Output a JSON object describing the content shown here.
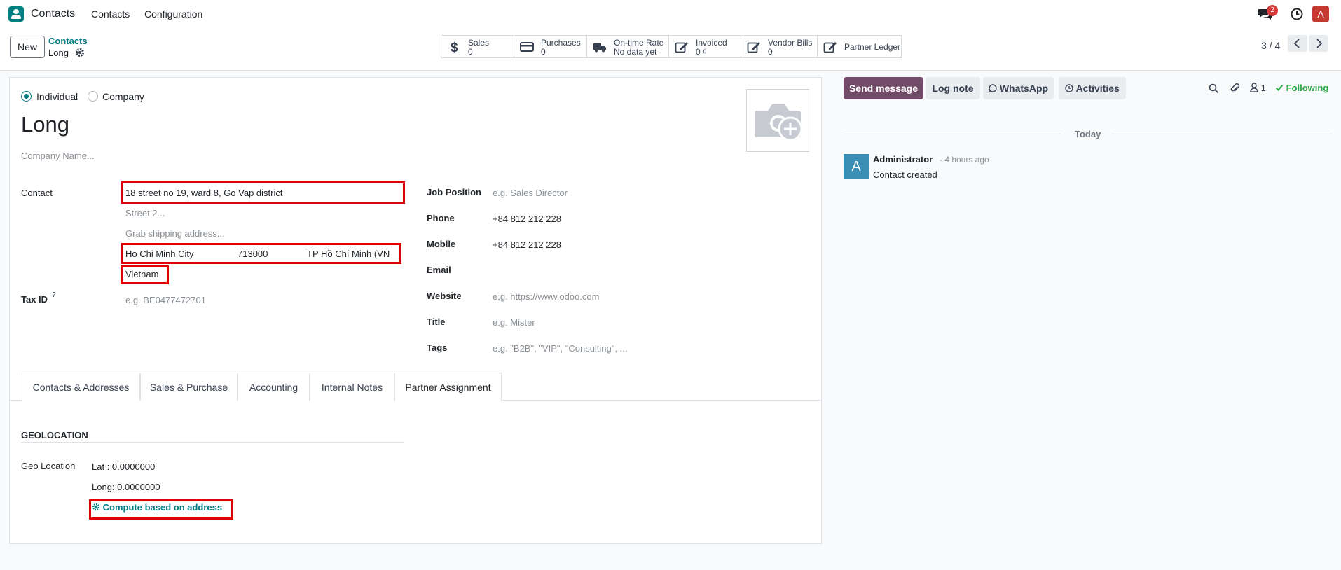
{
  "nav": {
    "app_name": "Contacts",
    "menu": [
      "Contacts",
      "Configuration"
    ],
    "messages_badge": "2",
    "avatar_letter": "A"
  },
  "control": {
    "new_label": "New",
    "breadcrumb_parent": "Contacts",
    "breadcrumb_current": "Long",
    "smart_buttons": [
      {
        "label": "Sales",
        "value": "0",
        "icon": "dollar-icon"
      },
      {
        "label": "Purchases",
        "value": "0",
        "icon": "credit-card-icon"
      },
      {
        "label": "On-time Rate",
        "value": "No data yet",
        "icon": "truck-icon"
      },
      {
        "label": "Invoiced",
        "value": "0 ₫",
        "icon": "pencil-square-icon"
      },
      {
        "label": "Vendor Bills",
        "value": "0",
        "icon": "pencil-square-icon"
      },
      {
        "label": "Partner Ledger",
        "value": "",
        "icon": "pencil-square-icon"
      }
    ],
    "pager": "3 / 4"
  },
  "form": {
    "type_individual": "Individual",
    "type_company": "Company",
    "selected_type": "Individual",
    "name": "Long",
    "company_placeholder": "Company Name...",
    "contact_label": "Contact",
    "street": "18 street no 19, ward 8, Go Vap district",
    "street2_placeholder": "Street 2...",
    "shipping_placeholder": "Grab shipping address...",
    "city": "Ho Chi Minh City",
    "zip": "713000",
    "state": "TP Hồ Chí Minh (VN",
    "country": "Vietnam",
    "tax_label": "Tax ID",
    "tax_help": "?",
    "tax_placeholder": "e.g. BE0477472701",
    "job_label": "Job Position",
    "job_placeholder": "e.g. Sales Director",
    "phone_label": "Phone",
    "phone": "+84 812 212 228",
    "mobile_label": "Mobile",
    "mobile": "+84 812 212 228",
    "email_label": "Email",
    "website_label": "Website",
    "website_placeholder": "e.g. https://www.odoo.com",
    "title_label": "Title",
    "title_placeholder": "e.g. Mister",
    "tags_label": "Tags",
    "tags_placeholder": "e.g. \"B2B\", \"VIP\", \"Consulting\", ..."
  },
  "tabs": [
    "Contacts & Addresses",
    "Sales & Purchase",
    "Accounting",
    "Internal Notes",
    "Partner Assignment"
  ],
  "active_tab": "Partner Assignment",
  "geo": {
    "section_title": "GEOLOCATION",
    "label": "Geo Location",
    "lat": "Lat : 0.0000000",
    "long": "Long: 0.0000000",
    "compute_label": "Compute based on address"
  },
  "chatter": {
    "send_message": "Send message",
    "log_note": "Log note",
    "whatsapp": "WhatsApp",
    "activities": "Activities",
    "followers_count": "1",
    "following": "Following",
    "date_separator": "Today",
    "author": "Administrator",
    "time": "- 4 hours ago",
    "body": "Contact created",
    "author_initial": "A"
  },
  "colors": {
    "accent": "#017e84",
    "primary_button": "#714b67",
    "highlight_box": "#e00000",
    "following_green": "#28a745"
  }
}
